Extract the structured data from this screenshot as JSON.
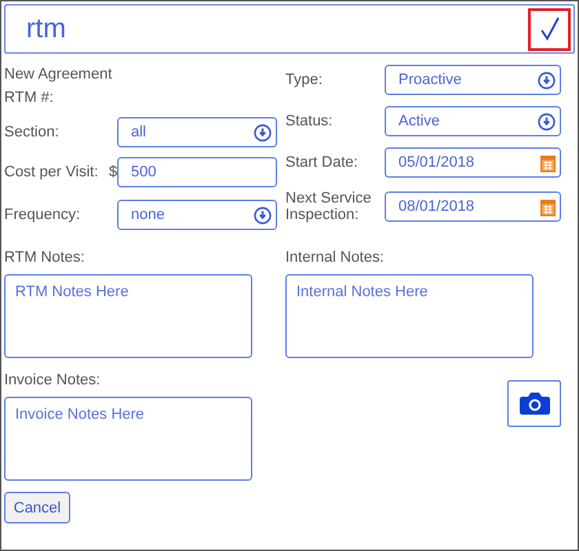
{
  "header": {
    "title": "rtm"
  },
  "agreement": {
    "heading": "New Agreement",
    "number_label": "RTM #:"
  },
  "left_fields": [
    {
      "kind": "select",
      "label": "Section:",
      "value": "all"
    },
    {
      "kind": "text",
      "label": "Cost per Visit:",
      "prefix": "$",
      "value": "500"
    },
    {
      "kind": "select",
      "label": "Frequency:",
      "value": "none"
    }
  ],
  "right_fields": [
    {
      "kind": "select",
      "label": "Type:",
      "value": "Proactive"
    },
    {
      "kind": "select",
      "label": "Status:",
      "value": "Active"
    },
    {
      "kind": "date",
      "label": "Start Date:",
      "value": "05/01/2018"
    },
    {
      "kind": "date",
      "label": "Next Service Inspection:",
      "value": "08/01/2018"
    }
  ],
  "notes": [
    {
      "label": "RTM Notes:",
      "value": "RTM Notes Here"
    },
    {
      "label": "Internal Notes:",
      "value": "Internal Notes Here"
    },
    {
      "label": "Invoice Notes:",
      "value": "Invoice Notes Here"
    }
  ],
  "cancel_button": "Cancel"
}
